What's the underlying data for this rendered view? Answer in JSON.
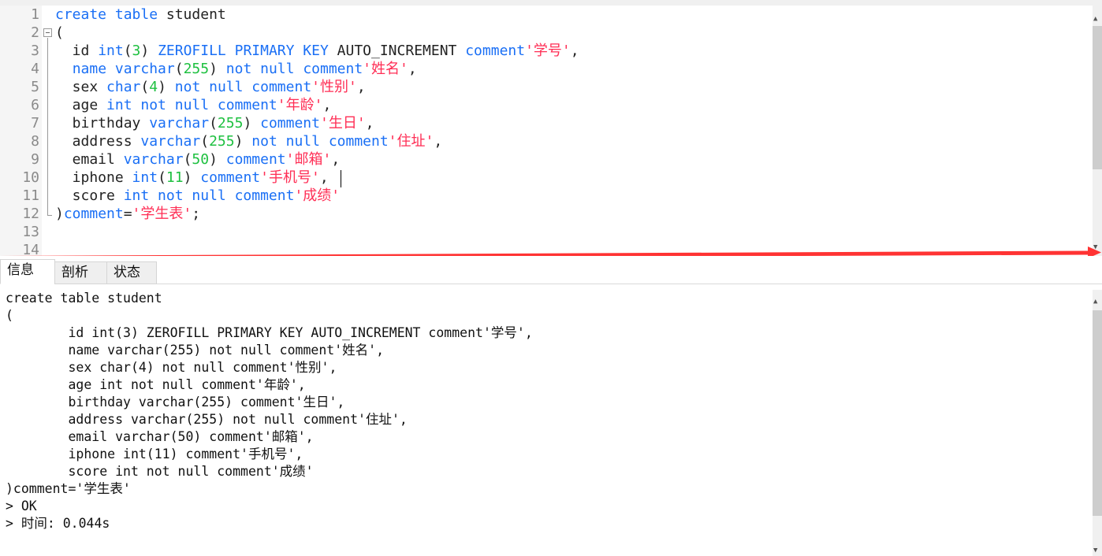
{
  "editor": {
    "line_numbers": [
      "1",
      "2",
      "3",
      "4",
      "5",
      "6",
      "7",
      "8",
      "9",
      "10",
      "11",
      "12",
      "13",
      "14"
    ],
    "lines": [
      [
        [
          "create table",
          "kw"
        ],
        [
          " student",
          "plain"
        ]
      ],
      [
        [
          "(",
          "plain"
        ]
      ],
      [
        [
          "  id ",
          "plain"
        ],
        [
          "int",
          "kw"
        ],
        [
          "(",
          "plain"
        ],
        [
          "3",
          "num"
        ],
        [
          ") ",
          "plain"
        ],
        [
          "ZEROFILL PRIMARY KEY",
          "kw"
        ],
        [
          " AUTO_INCREMENT ",
          "plain"
        ],
        [
          "comment",
          "kw"
        ],
        [
          "'学号'",
          "str"
        ],
        [
          ",",
          "plain"
        ]
      ],
      [
        [
          "  ",
          "plain"
        ],
        [
          "name varchar",
          "kw"
        ],
        [
          "(",
          "plain"
        ],
        [
          "255",
          "num"
        ],
        [
          ") ",
          "plain"
        ],
        [
          "not null comment",
          "kw"
        ],
        [
          "'姓名'",
          "str"
        ],
        [
          ",",
          "plain"
        ]
      ],
      [
        [
          "  sex ",
          "plain"
        ],
        [
          "char",
          "kw"
        ],
        [
          "(",
          "plain"
        ],
        [
          "4",
          "num"
        ],
        [
          ") ",
          "plain"
        ],
        [
          "not null comment",
          "kw"
        ],
        [
          "'性别'",
          "str"
        ],
        [
          ",",
          "plain"
        ]
      ],
      [
        [
          "  age ",
          "plain"
        ],
        [
          "int not null comment",
          "kw"
        ],
        [
          "'年龄'",
          "str"
        ],
        [
          ",",
          "plain"
        ]
      ],
      [
        [
          "  birthday ",
          "plain"
        ],
        [
          "varchar",
          "kw"
        ],
        [
          "(",
          "plain"
        ],
        [
          "255",
          "num"
        ],
        [
          ") ",
          "plain"
        ],
        [
          "comment",
          "kw"
        ],
        [
          "'生日'",
          "str"
        ],
        [
          ",",
          "plain"
        ]
      ],
      [
        [
          "  address ",
          "plain"
        ],
        [
          "varchar",
          "kw"
        ],
        [
          "(",
          "plain"
        ],
        [
          "255",
          "num"
        ],
        [
          ") ",
          "plain"
        ],
        [
          "not null comment",
          "kw"
        ],
        [
          "'住址'",
          "str"
        ],
        [
          ",",
          "plain"
        ]
      ],
      [
        [
          "  email ",
          "plain"
        ],
        [
          "varchar",
          "kw"
        ],
        [
          "(",
          "plain"
        ],
        [
          "50",
          "num"
        ],
        [
          ") ",
          "plain"
        ],
        [
          "comment",
          "kw"
        ],
        [
          "'邮箱'",
          "str"
        ],
        [
          ",",
          "plain"
        ]
      ],
      [
        [
          "  iphone ",
          "plain"
        ],
        [
          "int",
          "kw"
        ],
        [
          "(",
          "plain"
        ],
        [
          "11",
          "num"
        ],
        [
          ") ",
          "plain"
        ],
        [
          "comment",
          "kw"
        ],
        [
          "'手机号'",
          "str"
        ],
        [
          ",",
          "plain"
        ]
      ],
      [
        [
          "  score ",
          "plain"
        ],
        [
          "int not null comment",
          "kw"
        ],
        [
          "'成绩'",
          "str"
        ]
      ],
      [
        [
          ")",
          "plain"
        ],
        [
          "comment",
          "kw"
        ],
        [
          "=",
          "plain"
        ],
        [
          "'学生表'",
          "str"
        ],
        [
          ";",
          "plain"
        ]
      ],
      [],
      []
    ]
  },
  "tabs": [
    {
      "label": "信息",
      "active": true
    },
    {
      "label": "剖析"
    },
    {
      "label": "状态"
    }
  ],
  "output": {
    "lines": [
      "create table student",
      "(",
      "        id int(3) ZEROFILL PRIMARY KEY AUTO_INCREMENT comment'学号',",
      "        name varchar(255) not null comment'姓名',",
      "        sex char(4) not null comment'性别',",
      "        age int not null comment'年龄',",
      "        birthday varchar(255) comment'生日',",
      "        address varchar(255) not null comment'住址',",
      "        email varchar(50) comment'邮箱',",
      "        iphone int(11) comment'手机号',",
      "        score int not null comment'成绩'",
      ")comment='学生表'",
      "> OK",
      "> 时间: 0.044s"
    ]
  },
  "colors": {
    "keyword": "#1a6ff5",
    "number": "#1ec040",
    "string": "#ff2e55",
    "annotation_arrow": "#ff3333"
  }
}
